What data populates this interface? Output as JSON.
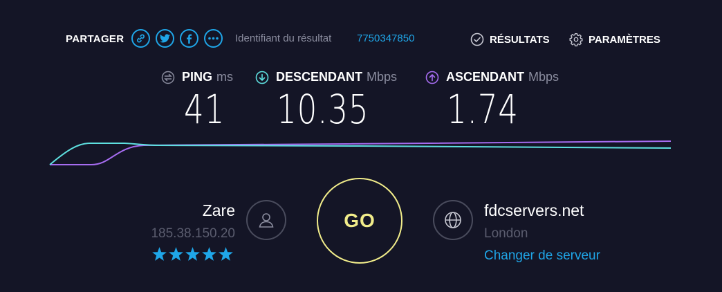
{
  "share": {
    "label": "PARTAGER",
    "icons": [
      "link-icon",
      "twitter-icon",
      "facebook-icon",
      "more-icon"
    ]
  },
  "result": {
    "label": "Identifiant du résultat",
    "id": "7750347850"
  },
  "nav": {
    "results_label": "RÉSULTATS",
    "settings_label": "PARAMÈTRES"
  },
  "metrics": {
    "ping": {
      "name": "PING",
      "unit": "ms",
      "value": "41",
      "icon": "ping-icon"
    },
    "download": {
      "name": "DESCENDANT",
      "unit": "Mbps",
      "value": "10.35",
      "icon": "download-arrow-icon"
    },
    "upload": {
      "name": "ASCENDANT",
      "unit": "Mbps",
      "value": "1.74",
      "icon": "upload-arrow-icon"
    }
  },
  "colors": {
    "background": "#141526",
    "accent_blue": "#1fa6e8",
    "download_line": "#5ee0e0",
    "upload_line": "#a66cf0",
    "go": "#f1ec8a",
    "muted": "#8b8d9f"
  },
  "isp": {
    "name": "Zare",
    "ip": "185.38.150.20",
    "rating": 5,
    "icon": "user-icon"
  },
  "go": {
    "label": "GO"
  },
  "server": {
    "host": "fdcservers.net",
    "city": "London",
    "change_label": "Changer de serveur",
    "icon": "globe-icon"
  }
}
